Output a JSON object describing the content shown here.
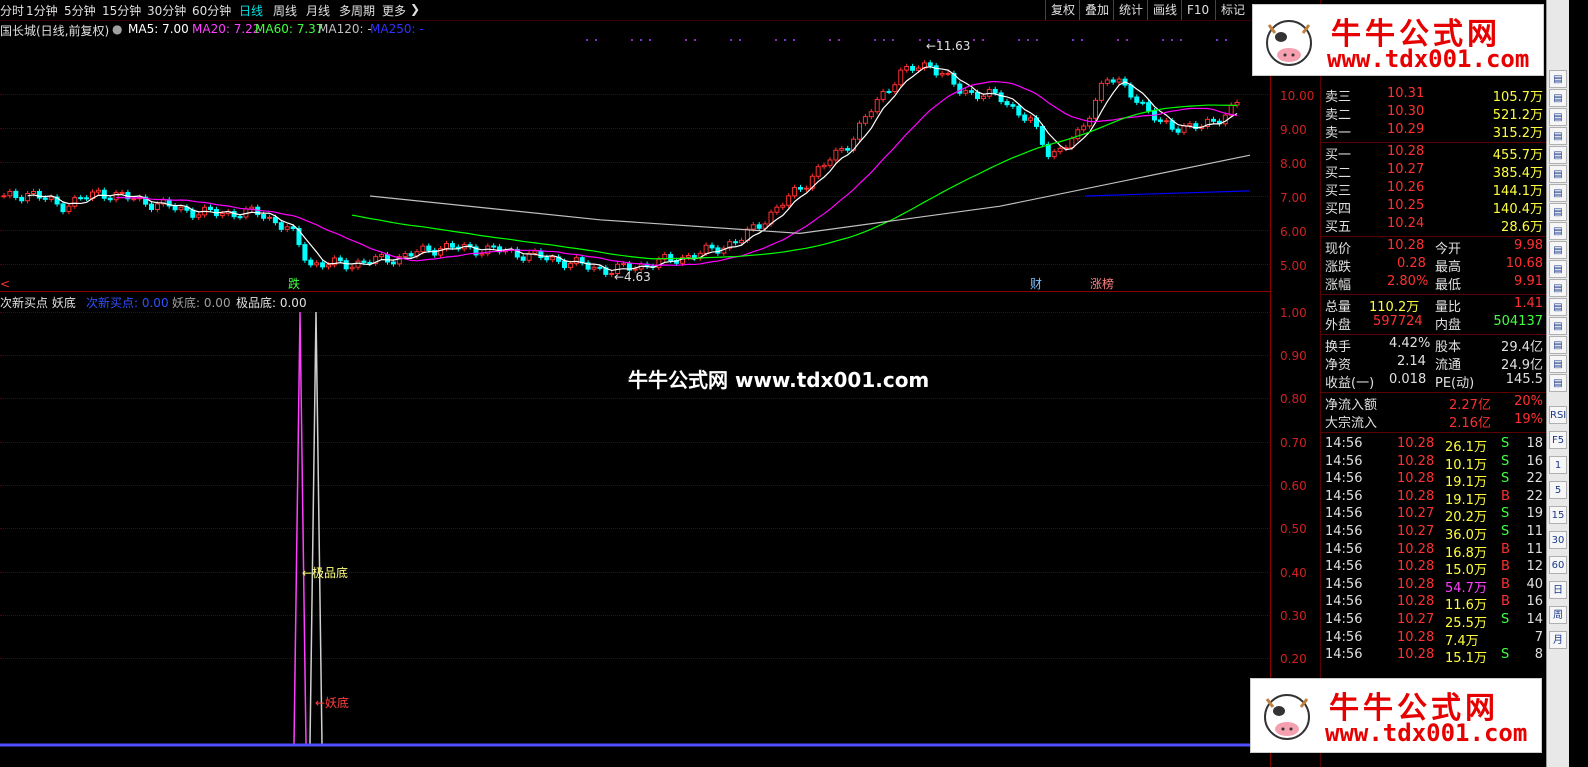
{
  "toolbar": {
    "periods": [
      "分时",
      "1分钟",
      "5分钟",
      "15分钟",
      "30分钟",
      "60分钟",
      "日线",
      "周线",
      "月线",
      "多周期",
      "更多"
    ],
    "active_period": "日线",
    "tools": [
      "复权",
      "叠加",
      "统计",
      "画线",
      "F10",
      "标记"
    ]
  },
  "title": "国长城(日线,前复权)",
  "ma": {
    "ma5": "MA5: 7.00",
    "ma20": "MA20: 7.22",
    "ma60": "MA60: 7.37",
    "ma120": "MA120: -",
    "ma250": "MA250: -"
  },
  "price_chart": {
    "high_label": "11.63",
    "low_label": "4.63",
    "axis": [
      "10.00",
      "9.00",
      "8.00",
      "7.00",
      "6.00",
      "5.00"
    ],
    "markers": [
      "跌",
      "财",
      "涨榜"
    ],
    "left_marker": "<"
  },
  "indicator": {
    "title": "次新买点 妖底",
    "legend": [
      "次新买点: 0.00",
      "妖底: 0.00",
      "极品底: 0.00"
    ],
    "axis": [
      "1.00",
      "0.90",
      "0.80",
      "0.70",
      "0.60",
      "0.50",
      "0.40",
      "0.30",
      "0.20"
    ],
    "annot_jp": "←极品底",
    "annot_yd": "←妖底"
  },
  "watermark": "牛牛公式网 www.tdx001.com",
  "badge": {
    "name": "牛牛公式网",
    "url": "www.tdx001.com"
  },
  "orderbook": {
    "asks": [
      {
        "label": "卖三",
        "price": "10.31",
        "vol": "105.7万"
      },
      {
        "label": "卖二",
        "price": "10.30",
        "vol": "521.2万"
      },
      {
        "label": "卖一",
        "price": "10.29",
        "vol": "315.2万"
      }
    ],
    "bids": [
      {
        "label": "买一",
        "price": "10.28",
        "vol": "455.7万"
      },
      {
        "label": "买二",
        "price": "10.27",
        "vol": "385.4万"
      },
      {
        "label": "买三",
        "price": "10.26",
        "vol": "144.1万"
      },
      {
        "label": "买四",
        "price": "10.25",
        "vol": "140.4万"
      },
      {
        "label": "买五",
        "price": "10.24",
        "vol": "28.6万"
      }
    ]
  },
  "quote": [
    {
      "l1": "现价",
      "v1": "10.28",
      "l2": "今开",
      "v2": "9.98"
    },
    {
      "l1": "涨跌",
      "v1": "0.28",
      "l2": "最高",
      "v2": "10.68"
    },
    {
      "l1": "涨幅",
      "v1": "2.80%",
      "l2": "最低",
      "v2": "9.91"
    }
  ],
  "volume": [
    {
      "l1": "总量",
      "v1": "110.2万",
      "l2": "量比",
      "v2": "1.41"
    },
    {
      "l1": "外盘",
      "v1": "597724",
      "l2": "内盘",
      "v2": "504137"
    }
  ],
  "fundamentals": [
    {
      "l1": "换手",
      "v1": "4.42%",
      "l2": "股本",
      "v2": "29.4亿"
    },
    {
      "l1": "净资",
      "v1": "2.14",
      "l2": "流通",
      "v2": "24.9亿"
    },
    {
      "l1": "收益(一)",
      "v1": "0.018",
      "l2": "PE(动)",
      "v2": "145.5"
    }
  ],
  "flows": [
    {
      "label": "净流入额",
      "value": "2.27亿",
      "pct": "20%"
    },
    {
      "label": "大宗流入",
      "value": "2.16亿",
      "pct": "19%"
    }
  ],
  "ticks": [
    {
      "t": "14:56",
      "p": "10.28",
      "v": "26.1万",
      "s": "S",
      "n": "18"
    },
    {
      "t": "14:56",
      "p": "10.28",
      "v": "10.1万",
      "s": "S",
      "n": "16"
    },
    {
      "t": "14:56",
      "p": "10.28",
      "v": "19.1万",
      "s": "S",
      "n": "22"
    },
    {
      "t": "14:56",
      "p": "10.28",
      "v": "19.1万",
      "s": "B",
      "n": "22"
    },
    {
      "t": "14:56",
      "p": "10.27",
      "v": "20.2万",
      "s": "S",
      "n": "19"
    },
    {
      "t": "14:56",
      "p": "10.27",
      "v": "36.0万",
      "s": "S",
      "n": "11"
    },
    {
      "t": "14:56",
      "p": "10.28",
      "v": "16.8万",
      "s": "B",
      "n": "11"
    },
    {
      "t": "14:56",
      "p": "10.28",
      "v": "15.0万",
      "s": "B",
      "n": "12"
    },
    {
      "t": "14:56",
      "p": "10.28",
      "v": "54.7万",
      "s": "B",
      "n": "40"
    },
    {
      "t": "14:56",
      "p": "10.28",
      "v": "11.6万",
      "s": "B",
      "n": "16"
    },
    {
      "t": "14:56",
      "p": "10.27",
      "v": "25.5万",
      "s": "S",
      "n": "14"
    },
    {
      "t": "14:56",
      "p": "10.28",
      "v": "7.4万",
      "s": "",
      "n": "7"
    },
    {
      "t": "14:56",
      "p": "10.28",
      "v": "15.1万",
      "s": "S",
      "n": "8"
    }
  ],
  "iconbar": [
    "RSI",
    "F5",
    "1",
    "5",
    "15",
    "30",
    "60",
    "日",
    "周",
    "月"
  ],
  "colors": {
    "up": "#ff3030",
    "down": "#00ffff",
    "ma5": "#ffffff",
    "ma20": "#ff00ff",
    "ma60": "#00ff00",
    "ma120": "#c0c0c0",
    "ma250": "#0000ff"
  }
}
